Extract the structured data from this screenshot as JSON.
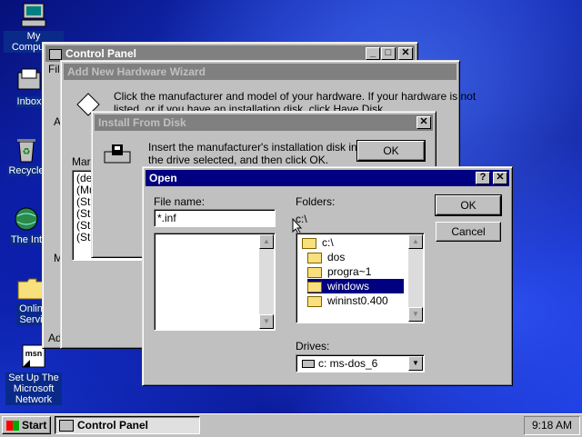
{
  "desktop": {
    "icons": [
      {
        "label": "My Computer"
      },
      {
        "label": "Inbox"
      },
      {
        "label": "Recycle"
      },
      {
        "label": "The Int"
      },
      {
        "label": "Onlin Servi"
      },
      {
        "label": "Set Up The Microsoft Network"
      }
    ]
  },
  "control_panel": {
    "title": "Control Panel",
    "menu_first": "Fil",
    "side_letter_a": "A",
    "side_letter_m": "M",
    "status_fragment": "Add"
  },
  "wizard": {
    "title": "Add New Hardware Wizard",
    "instruction": "Click the manufacturer and model of your hardware. If your hardware is not listed, or if you have an installation disk, click Have Disk.",
    "instruction_line1": "Click the manufacturer and model of your hardware. If your hardware is not",
    "instruction_line2": "listed, or if you have an installation disk, click Have Disk.",
    "manufacturers_label": "Mar",
    "list_items": [
      "(de",
      "(Mu",
      "(St",
      "(St",
      "(St",
      "(St"
    ]
  },
  "install_disk": {
    "title": "Install From Disk",
    "message_line1": "Insert the manufacturer's installation disk into",
    "message_line2": "the drive selected, and then click OK.",
    "ok_label": "OK"
  },
  "open_dialog": {
    "title": "Open",
    "help_btn": "?",
    "close_btn": "✕",
    "file_name_label": "File name:",
    "file_name_value": "*.inf",
    "folders_label": "Folders:",
    "current_path": "c:\\",
    "folders": [
      {
        "name": "c:\\",
        "open": true,
        "selected": false
      },
      {
        "name": "dos",
        "open": false,
        "selected": false
      },
      {
        "name": "progra~1",
        "open": false,
        "selected": false
      },
      {
        "name": "windows",
        "open": false,
        "selected": true
      },
      {
        "name": "wininst0.400",
        "open": false,
        "selected": false
      }
    ],
    "drives_label": "Drives:",
    "drive_value": "c: ms-dos_6",
    "ok_label": "OK",
    "cancel_label": "Cancel"
  },
  "taskbar": {
    "start_label": "Start",
    "task_label": "Control Panel",
    "clock": "9:18 AM"
  }
}
